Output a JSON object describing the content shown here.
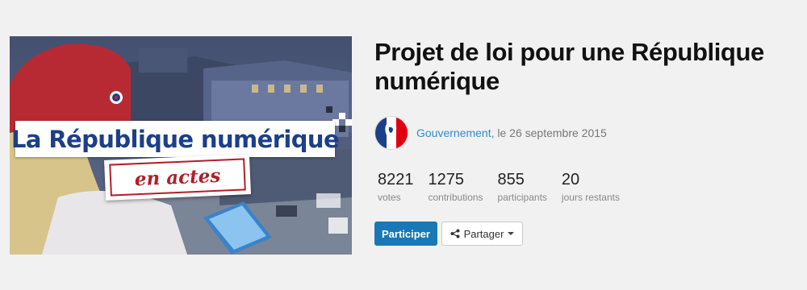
{
  "project": {
    "title": "Projet de loi pour une République numérique"
  },
  "cover": {
    "banner_main": "La République numérique",
    "banner_sub": "en actes"
  },
  "author": {
    "name": "Gouvernement",
    "separator": ",",
    "date": "le 26 septembre 2015",
    "avatar_icon": "marianne-logo-icon"
  },
  "stats": [
    {
      "value": "8221",
      "label": "votes"
    },
    {
      "value": "1275",
      "label": "contributions"
    },
    {
      "value": "855",
      "label": "participants"
    },
    {
      "value": "20",
      "label": "jours restants"
    }
  ],
  "actions": {
    "participate_label": "Participer",
    "share_label": "Partager",
    "share_icon": "share-icon"
  },
  "colors": {
    "primary": "#1978b5",
    "link": "#2d8fc6",
    "banner_blue": "#1c3f87",
    "banner_red": "#b0202a",
    "background": "#f1f1f1"
  }
}
